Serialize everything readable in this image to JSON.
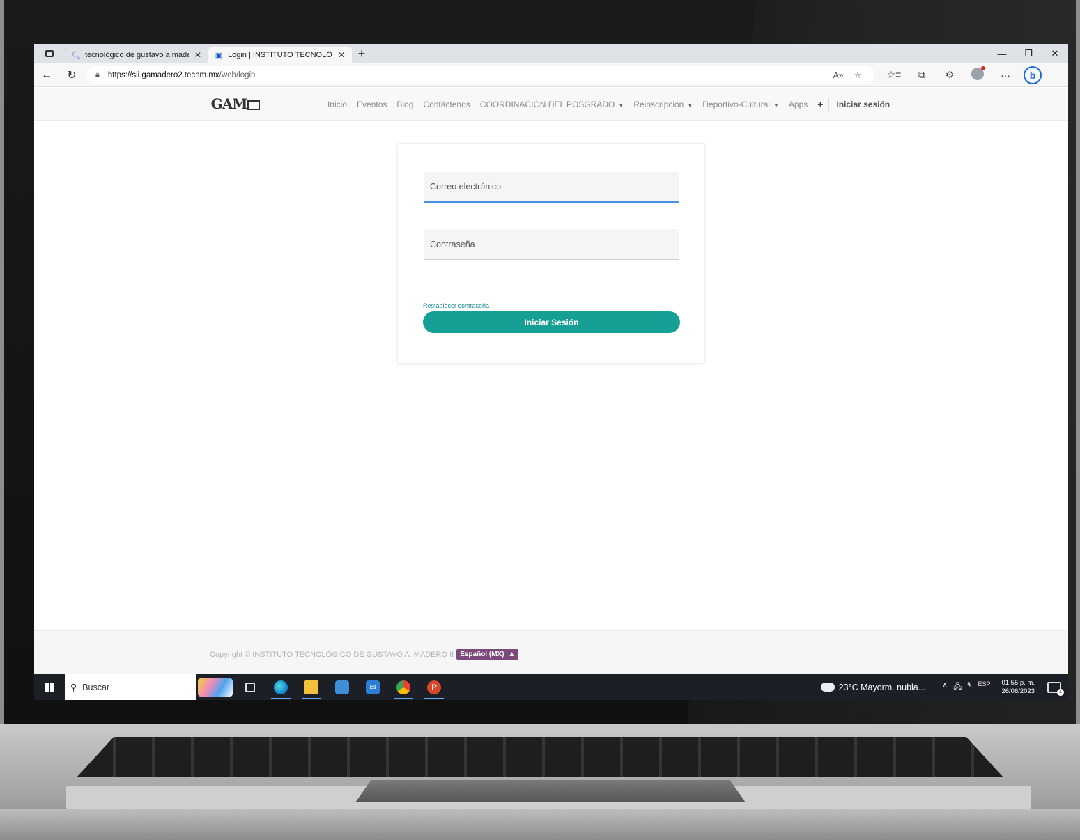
{
  "browser": {
    "tabs": [
      {
        "title": "tecnológico de gustavo a madero",
        "icon": "search-icon",
        "active": false
      },
      {
        "title": "Login | INSTITUTO TECNOLÓGICO",
        "icon": "site-favicon-icon",
        "active": true
      }
    ],
    "new_tab_label": "+",
    "url_domain": "https://sii.gamadero2.tecnm.mx",
    "url_path": "/web/login"
  },
  "site": {
    "logo_text": "GAM",
    "nav": {
      "inicio": "Inicio",
      "eventos": "Eventos",
      "blog": "Blog",
      "contactenos": "Contáctenos",
      "posgrado": "COORDINACIÓN DEL POSGRADO",
      "reinscripcion": "Reinscripción",
      "deportivo": "Deportivo-Cultural",
      "apps": "Apps",
      "plus": "+",
      "signin": "Iniciar sesión"
    }
  },
  "login": {
    "email_placeholder": "Correo electrónico",
    "password_placeholder": "Contraseña",
    "reset_link": "Restablecer contraseña",
    "submit_label": "Iniciar Sesión"
  },
  "footer": {
    "copyright": "Copyright © INSTITUTO TECNOLÓGICO DE GUSTAVO A. MADERO II",
    "language": "Español (MX)"
  },
  "taskbar": {
    "search_label": "Buscar",
    "weather": "23°C  Mayorm. nubla...",
    "input_language": "ESP",
    "time": "01:55 p. m.",
    "date": "26/06/2023",
    "notification_count": "1"
  },
  "colors": {
    "primary_button": "#16a095",
    "language_badge": "#7b4a7a",
    "input_focus": "#4a90e2"
  }
}
